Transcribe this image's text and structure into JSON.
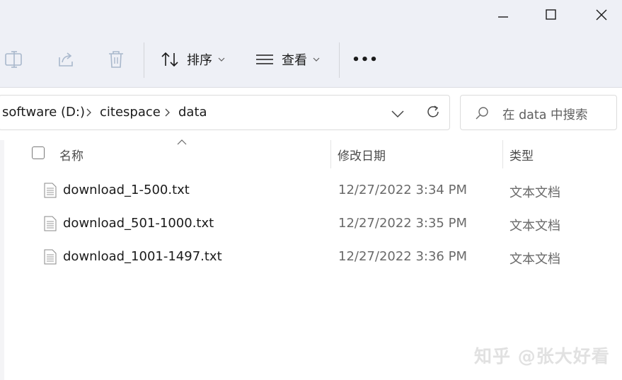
{
  "window": {
    "controls": [
      "minimize",
      "maximize",
      "close"
    ]
  },
  "toolbar": {
    "icons": [
      "rename-icon",
      "share-icon",
      "delete-icon"
    ],
    "sort_label": "排序",
    "view_label": "查看",
    "more_label": "•••"
  },
  "address": {
    "breadcrumbs": [
      "software (D:)",
      "citespace",
      "data"
    ]
  },
  "search": {
    "placeholder": "在 data 中搜索"
  },
  "columns": {
    "name": "名称",
    "modified": "修改日期",
    "type": "类型"
  },
  "files": [
    {
      "name": "download_1-500.txt",
      "modified": "12/27/2022 3:34 PM",
      "type": "文本文档"
    },
    {
      "name": "download_501-1000.txt",
      "modified": "12/27/2022 3:35 PM",
      "type": "文本文档"
    },
    {
      "name": "download_1001-1497.txt",
      "modified": "12/27/2022 3:36 PM",
      "type": "文本文档"
    }
  ],
  "watermark": "知乎 @张大好看"
}
